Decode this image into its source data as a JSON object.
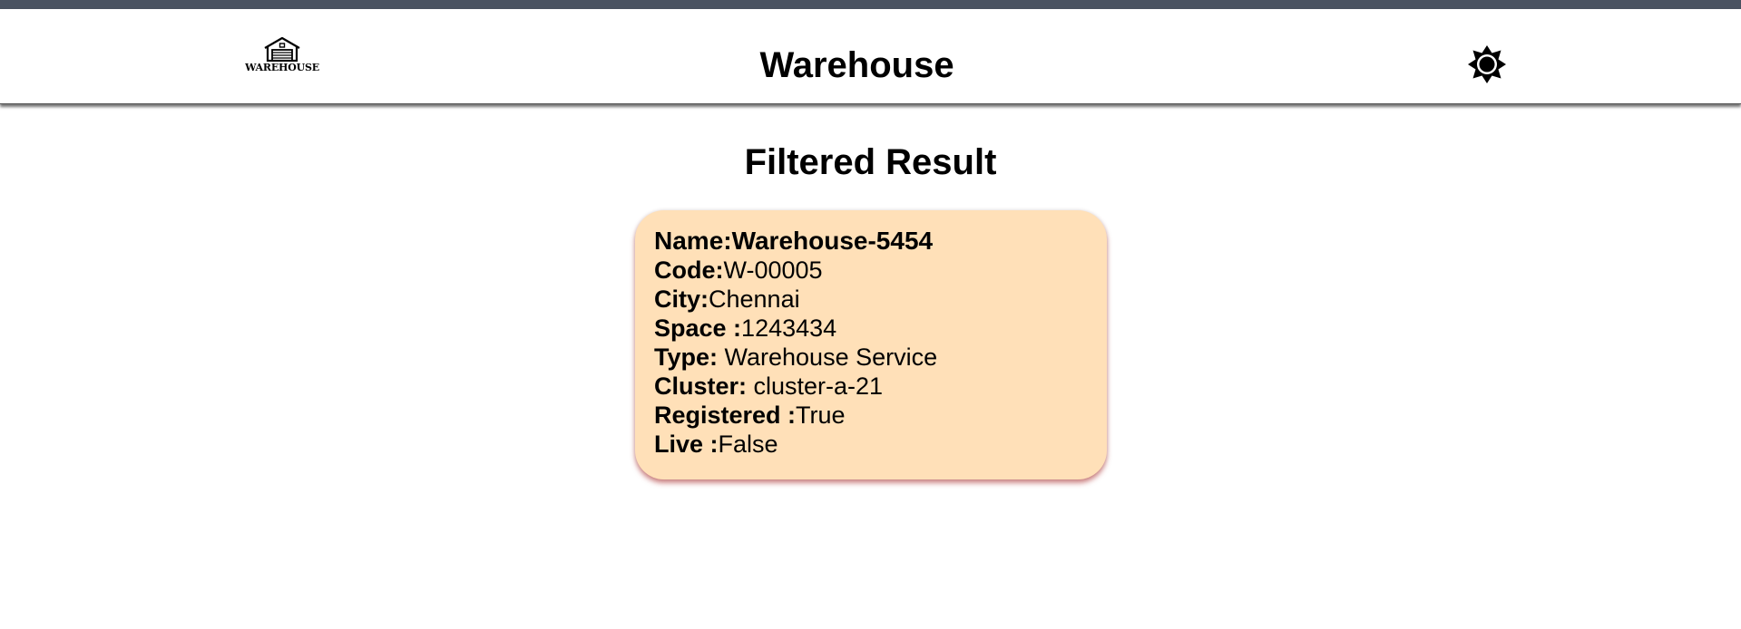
{
  "header": {
    "logo_text": "WAREHOUSE",
    "logo_icon": "warehouse-icon",
    "title": "Warehouse",
    "theme_icon": "sun-icon"
  },
  "main": {
    "section_title": "Filtered Result",
    "card": {
      "name_label": "Name:",
      "name_value": "Warehouse-5454",
      "code_label": "Code:",
      "code_value": "W-00005",
      "city_label": "City:",
      "city_value": "Chennai",
      "space_label": "Space :",
      "space_value": "1243434",
      "type_label": "Type:",
      "type_value": " Warehouse Service",
      "cluster_label": "Cluster:",
      "cluster_value": " cluster-a-21",
      "registered_label": "Registered :",
      "registered_value": "True",
      "live_label": "Live :",
      "live_value": "False"
    }
  },
  "colors": {
    "top_strip": "#4a5261",
    "card_background": "#ffe0b8",
    "card_shadow": "#aa2828"
  }
}
